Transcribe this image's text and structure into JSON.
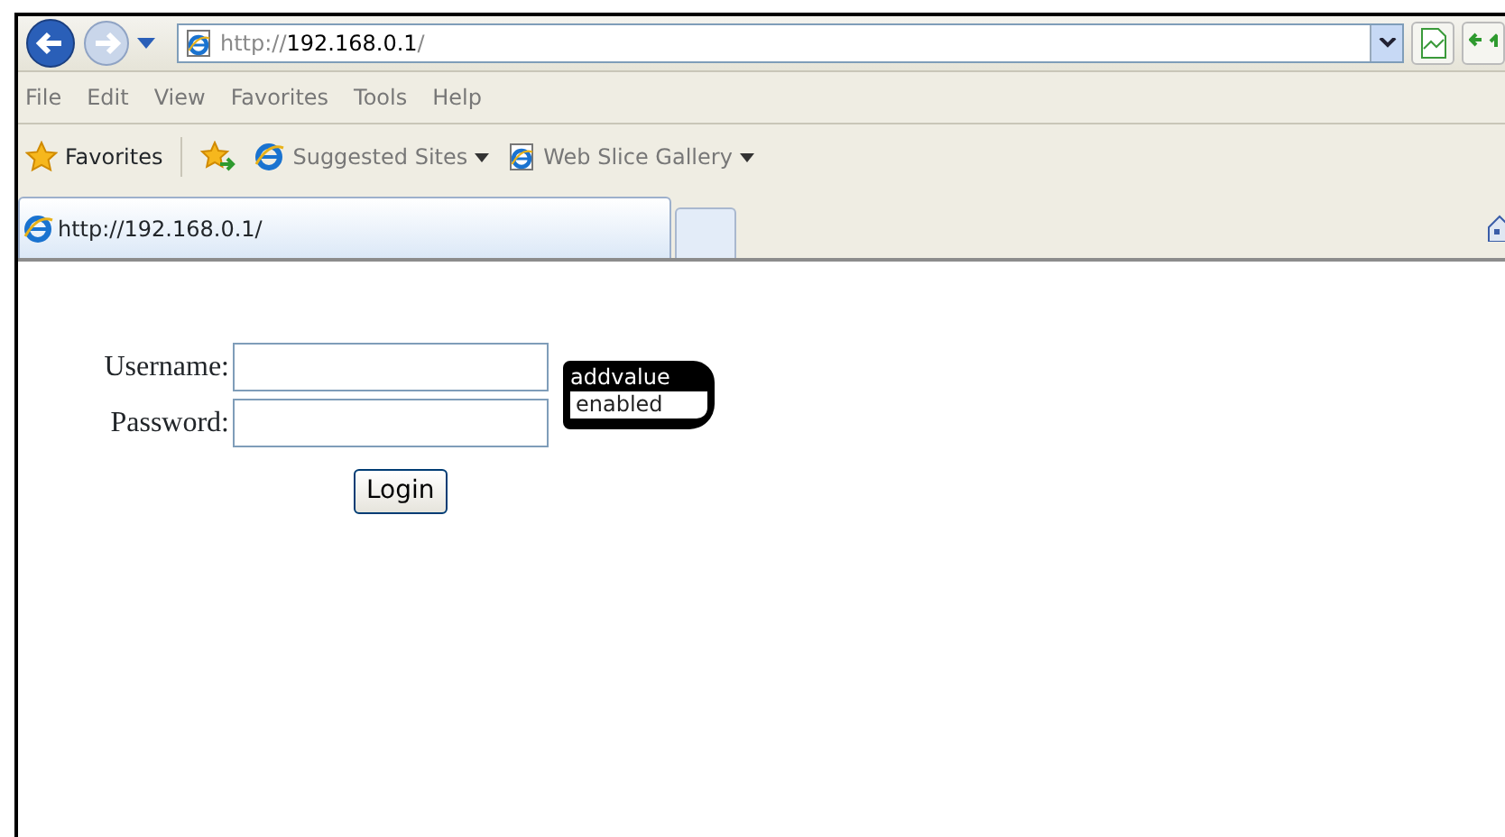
{
  "address_bar": {
    "url": "http://**192.168.0.1**/"
  },
  "menu_bar": [
    "File",
    "Edit",
    "View",
    "Favorites",
    "Tools",
    "Help"
  ],
  "favorites_bar": {
    "favorites": "Favorites",
    "links": [
      {
        "label": "Suggested Sites",
        "kind": "ie"
      },
      {
        "label": "Web Slice Gallery",
        "kind": "page"
      }
    ]
  },
  "tabs": [
    {
      "label": "http://192.168.0.1/",
      "selected": true
    },
    {
      "selected": false
    }
  ],
  "login_form": {
    "fields": [
      {
        "label": "Username:"
      },
      {
        "label": "Password:"
      }
    ],
    "button": "Login",
    "logo": {
      "top": "addvalue",
      "bottom": "enabled"
    }
  }
}
